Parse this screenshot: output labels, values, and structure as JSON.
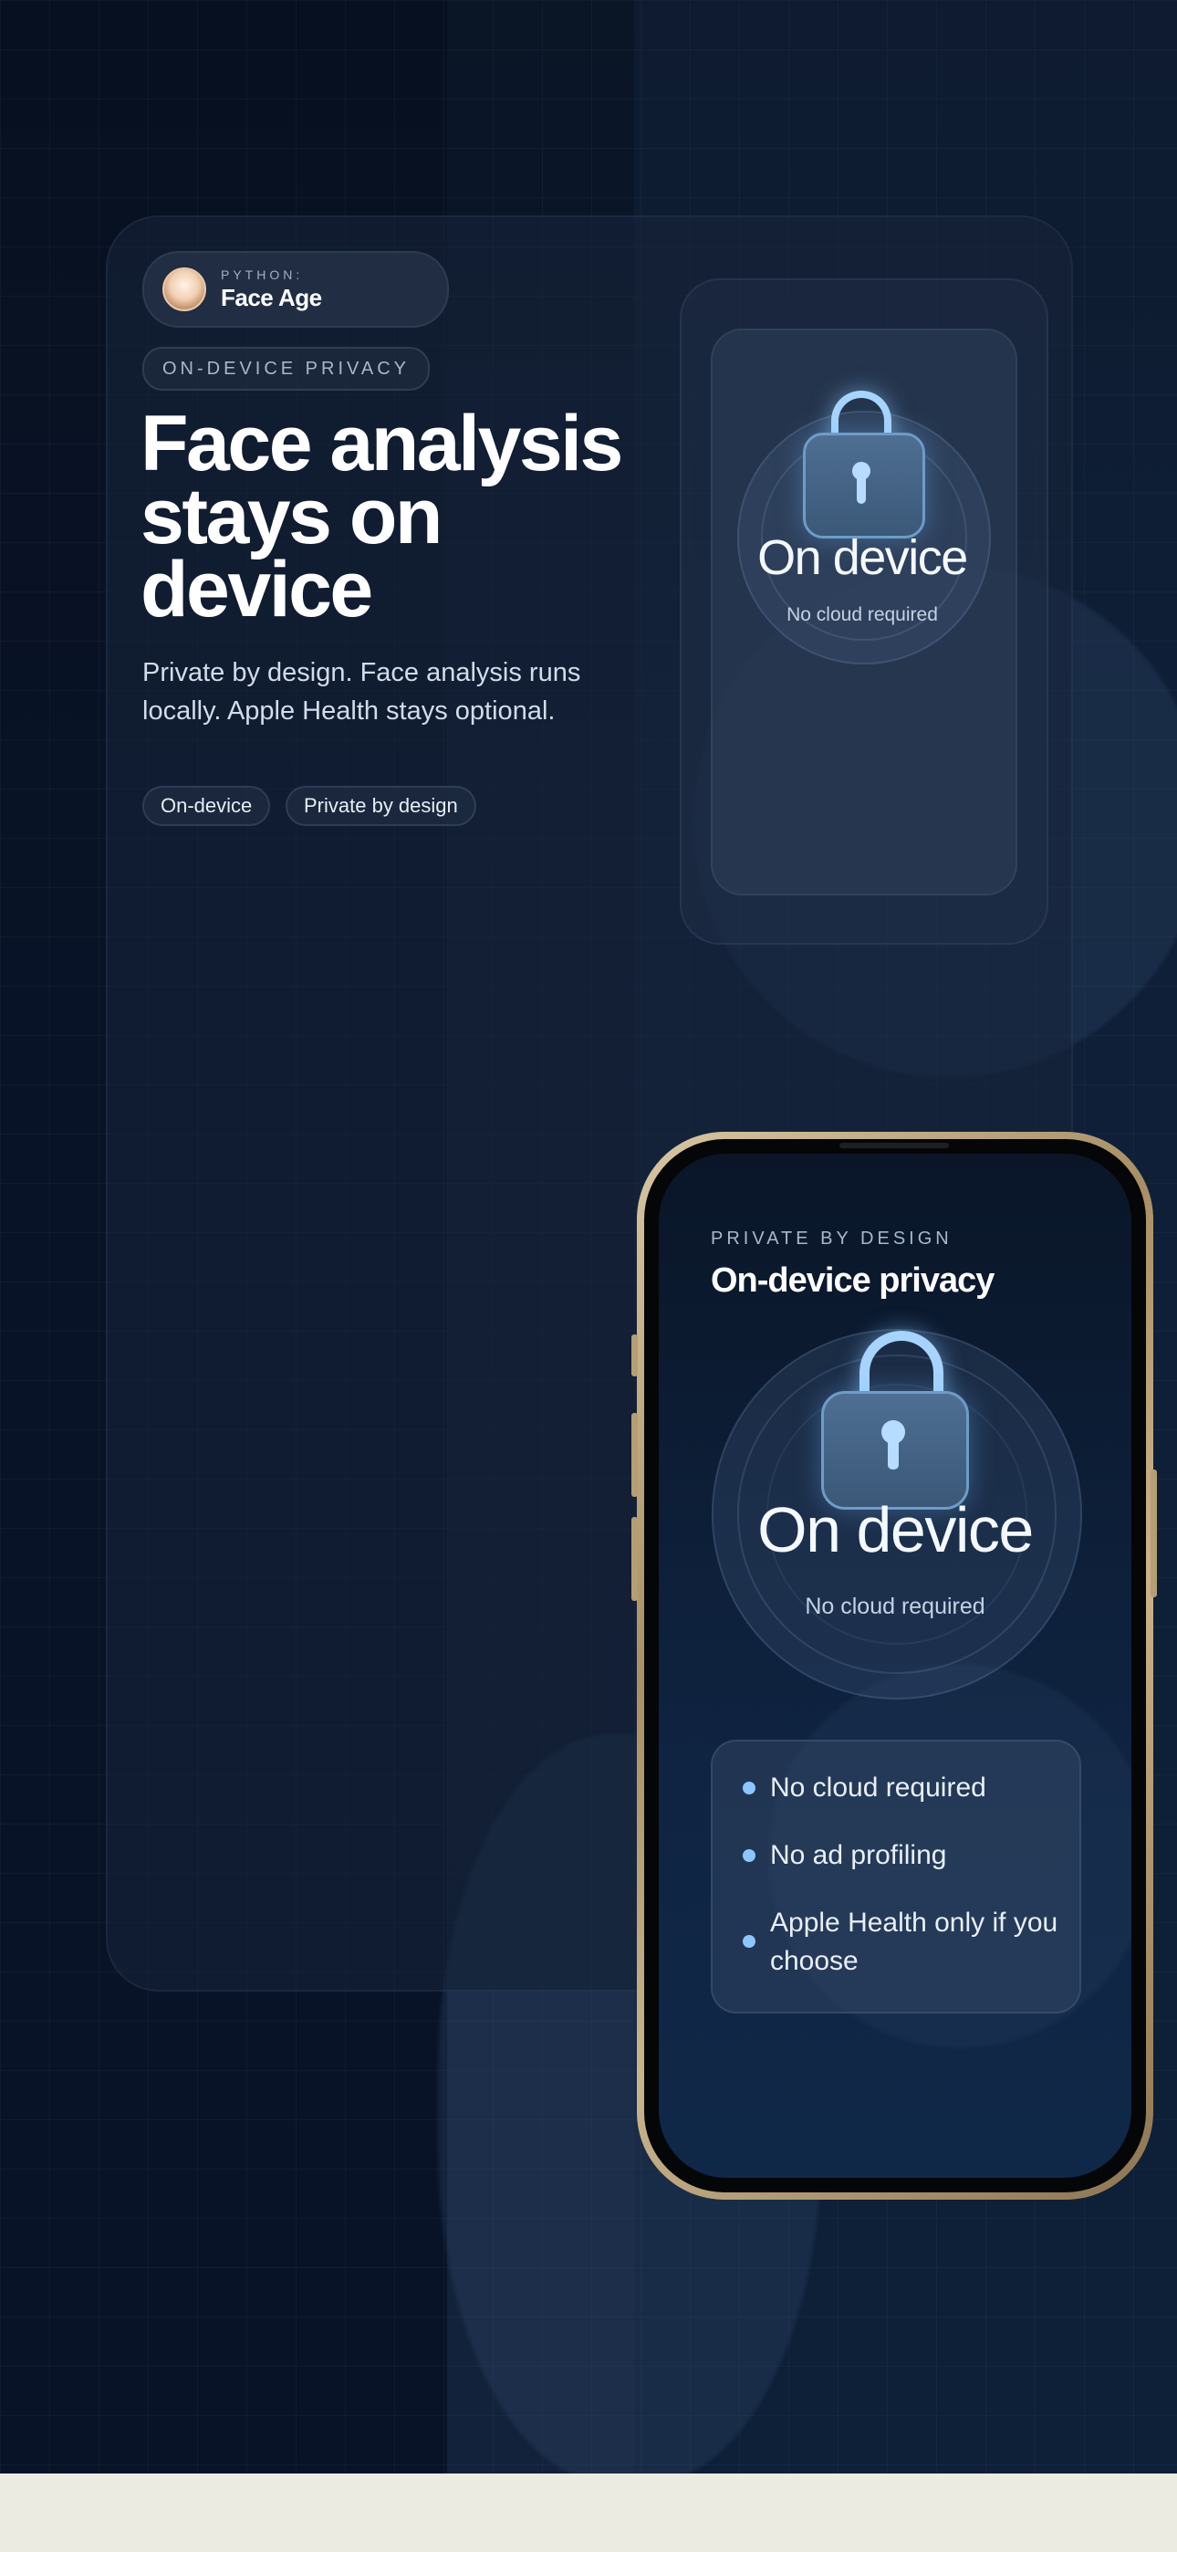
{
  "app": {
    "sub": "PYTHON:",
    "name": "Face Age"
  },
  "tag": "ON-DEVICE PRIVACY",
  "headline": "Face analysis stays on device",
  "subtitle": "Private by design. Face analysis runs locally. Apple Health stays optional.",
  "chips": [
    "On-device",
    "Private by design"
  ],
  "preview": {
    "big": "On device",
    "small": "No cloud required"
  },
  "phone": {
    "eyebrow": "PRIVATE BY DESIGN",
    "title": "On-device privacy",
    "big": "On device",
    "small": "No cloud required",
    "list": [
      "No cloud required",
      "No ad profiling",
      "Apple Health only if you choose"
    ]
  },
  "colors": {
    "accent": "#8cc6ff",
    "background": "#0b1a30",
    "footer": "#ecebe1"
  }
}
